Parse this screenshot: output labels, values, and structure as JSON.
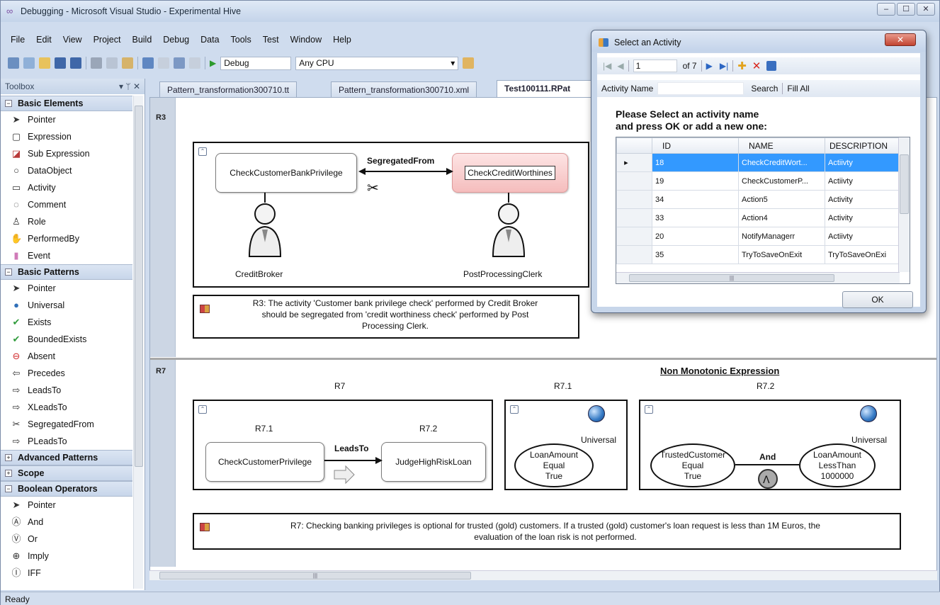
{
  "window": {
    "title": "Debugging - Microsoft Visual Studio - Experimental Hive",
    "buttons": [
      "–",
      "☐",
      "✕"
    ]
  },
  "menu": [
    "File",
    "Edit",
    "View",
    "Project",
    "Build",
    "Debug",
    "Data",
    "Tools",
    "Test",
    "Window",
    "Help"
  ],
  "toolbar": {
    "config": "Debug",
    "platform": "Any CPU"
  },
  "toolbox": {
    "title": "Toolbox",
    "header_buttons": "▾ ᛘ ✕",
    "groups": [
      {
        "label": "Basic Elements",
        "expanded": true,
        "items": [
          {
            "label": "Pointer",
            "icon": "pointer-icon"
          },
          {
            "label": "Expression",
            "icon": "expression-icon"
          },
          {
            "label": "Sub Expression",
            "icon": "sub-expression-icon"
          },
          {
            "label": "DataObject",
            "icon": "dataobject-icon"
          },
          {
            "label": "Activity",
            "icon": "activity-icon"
          },
          {
            "label": "Comment",
            "icon": "comment-icon"
          },
          {
            "label": "Role",
            "icon": "role-icon"
          },
          {
            "label": "PerformedBy",
            "icon": "performedby-icon"
          },
          {
            "label": "Event",
            "icon": "event-icon"
          }
        ]
      },
      {
        "label": "Basic Patterns",
        "expanded": true,
        "items": [
          {
            "label": "Pointer",
            "icon": "pointer-icon"
          },
          {
            "label": "Universal",
            "icon": "universal-icon"
          },
          {
            "label": "Exists",
            "icon": "exists-icon"
          },
          {
            "label": "BoundedExists",
            "icon": "boundedexists-icon"
          },
          {
            "label": "Absent",
            "icon": "absent-icon"
          },
          {
            "label": "Precedes",
            "icon": "precedes-icon"
          },
          {
            "label": "LeadsTo",
            "icon": "leadsto-icon"
          },
          {
            "label": "XLeadsTo",
            "icon": "xleadsto-icon"
          },
          {
            "label": "SegregatedFrom",
            "icon": "segregatedfrom-icon"
          },
          {
            "label": "PLeadsTo",
            "icon": "pleadsto-icon"
          }
        ]
      },
      {
        "label": "Advanced Patterns",
        "expanded": false,
        "items": []
      },
      {
        "label": "Scope",
        "expanded": false,
        "items": []
      },
      {
        "label": "Boolean Operators",
        "expanded": true,
        "items": [
          {
            "label": "Pointer",
            "icon": "pointer-icon"
          },
          {
            "label": "And",
            "icon": "and-icon"
          },
          {
            "label": "Or",
            "icon": "or-icon"
          },
          {
            "label": "Imply",
            "icon": "imply-icon"
          },
          {
            "label": "IFF",
            "icon": "iff-icon"
          }
        ]
      }
    ]
  },
  "tabs": [
    "Pattern_transformation300710.tt",
    "Pattern_transformation300710.xml",
    "Test100111.RPat"
  ],
  "r3": {
    "row_label": "R3",
    "left_activity": "CheckCustomerBankPrivilege",
    "right_activity": "CheckCreditWorthines",
    "relation": "SegregatedFrom",
    "left_role": "CreditBroker",
    "right_role": "PostProcessingClerk",
    "note": [
      "R3: The activity 'Customer bank privilege check' performed by Credit Broker",
      "should be segregated from 'credit worthiness check' performed by Post",
      "Processing Clerk."
    ]
  },
  "r7": {
    "row_label": "R7",
    "heading": "Non Monotonic Expression",
    "col_r7": "R7",
    "col_r71": "R7.1",
    "col_r72": "R7.2",
    "inner_r71": "R7.1",
    "inner_r72": "R7.2",
    "left_activity": "CheckCustomerPrivilege",
    "right_activity": "JudgeHighRiskLoan",
    "relation": "LeadsTo",
    "universal_label": "Universal",
    "loan_equal": [
      "LoanAmount",
      "Equal",
      "True"
    ],
    "trusted_equal": [
      "TrustedCustomer",
      "Equal",
      "True"
    ],
    "and_label": "And",
    "loan_lt": [
      "LoanAmount",
      "LessThan",
      "1000000"
    ],
    "note": [
      "R7: Checking banking privileges is optional for trusted (gold) customers.  If a trusted (gold) customer's loan request is less than 1M Euros, the",
      "evaluation of the loan risk is not performed."
    ]
  },
  "dialog": {
    "title": "Select an Activity",
    "position": "1",
    "of": "of 7",
    "search_label": "Activity Name",
    "search_value": "",
    "search_button": "Search",
    "fill_all": "Fill All",
    "prompt": [
      "Please Select an activity name",
      "and press OK or add a new one:"
    ],
    "columns": [
      "ID",
      "NAME",
      "DESCRIPTION"
    ],
    "rows": [
      [
        "18",
        "CheckCreditWort...",
        "Actiivty"
      ],
      [
        "19",
        "CheckCustomerP...",
        "Actiivty"
      ],
      [
        "34",
        "Action5",
        "Activity"
      ],
      [
        "33",
        "Action4",
        "Activity"
      ],
      [
        "20",
        "NotifyManagerr",
        "Actiivty"
      ],
      [
        "35",
        "TryToSaveOnExit",
        "TryToSaveOnExi"
      ]
    ],
    "ok": "OK"
  },
  "status": "Ready"
}
